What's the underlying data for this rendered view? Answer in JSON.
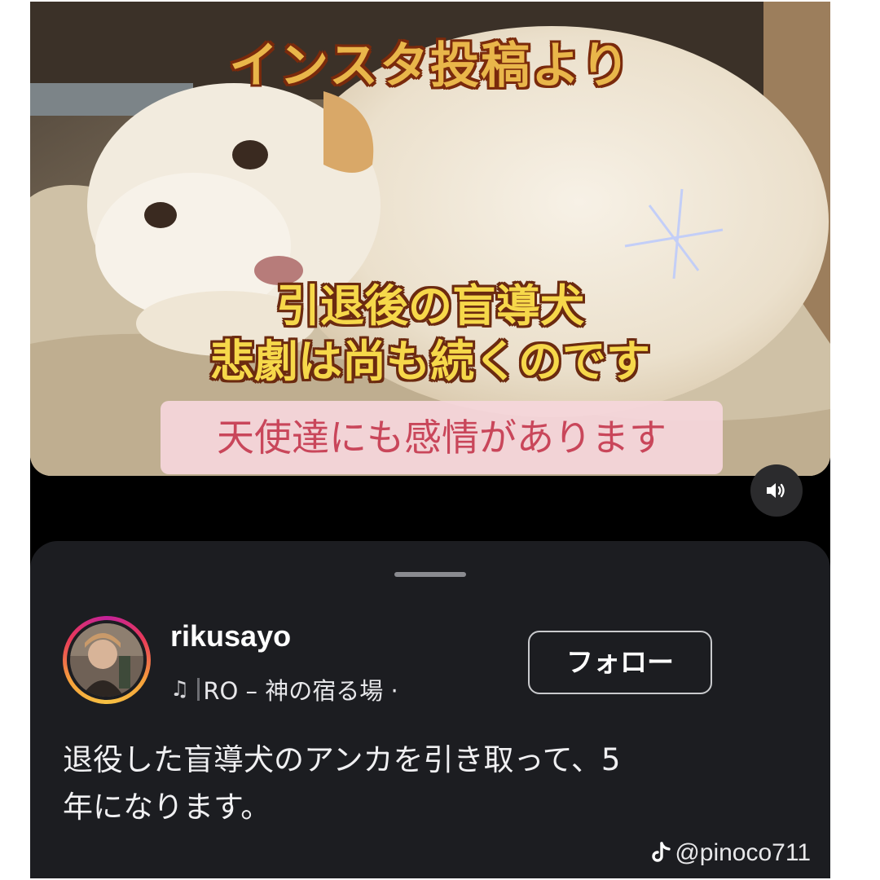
{
  "video": {
    "title": "インスタ投稿より",
    "caption_line1": "引退後の盲導犬",
    "caption_line2": "悲劇は尚も続くのです",
    "pill_text": "天使達にも感情があります",
    "sound_icon": "speaker-icon"
  },
  "profile": {
    "username": "rikusayo",
    "music_note_icon": "music-note-icon",
    "music_text": "RO – 神の宿る場 ·",
    "follow_label": "フォロー"
  },
  "post": {
    "line1": "退役した盲導犬のアンカを引き取って、5",
    "line2": "年になります。"
  },
  "watermark": {
    "icon": "tiktok-icon",
    "handle": "@pinoco711"
  },
  "colors": {
    "title_fill": "#e9b64a",
    "caption_fill": "#f6d84a",
    "pill_text": "#c9465a",
    "sheet_bg": "#1c1d21"
  }
}
